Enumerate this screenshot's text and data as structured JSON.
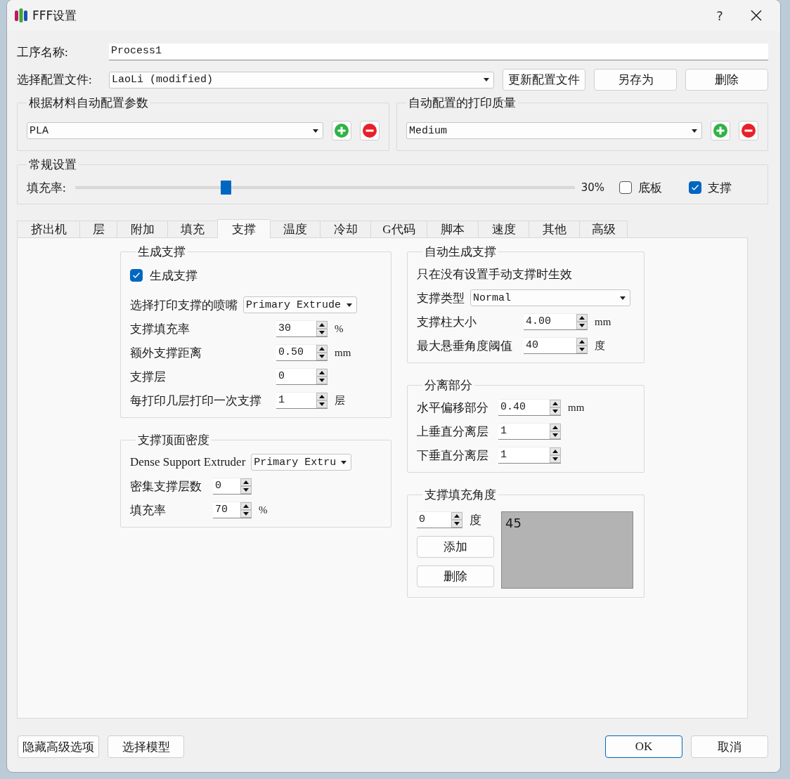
{
  "window": {
    "title": "FFF设置",
    "help": "?"
  },
  "process_name": {
    "label": "工序名称:",
    "value": "Process1"
  },
  "profile": {
    "label": "选择配置文件:",
    "value": "LaoLi (modified)",
    "buttons": [
      "更新配置文件",
      "另存为",
      "删除"
    ]
  },
  "auto_groups": [
    {
      "title": "根据材料自动配置参数",
      "value": "PLA"
    },
    {
      "title": "自动配置的打印质量",
      "value": "Medium"
    }
  ],
  "general": {
    "title": "常规设置",
    "infill_label": "填充率:",
    "infill": {
      "level": 0.3
    },
    "infill_reading": "30%",
    "checkboxes": [
      {
        "label": "底板",
        "checked": false
      },
      {
        "label": "支撑",
        "checked": true
      }
    ]
  },
  "tabs": [
    {
      "label": "挤出机",
      "selected": false
    },
    {
      "label": "层",
      "selected": false
    },
    {
      "label": "附加",
      "selected": false
    },
    {
      "label": "填充",
      "selected": false
    },
    {
      "label": "支撑",
      "selected": true
    },
    {
      "label": "温度",
      "selected": false
    },
    {
      "label": "冷却",
      "selected": false
    },
    {
      "label": "G代码",
      "selected": false
    },
    {
      "label": "脚本",
      "selected": false
    },
    {
      "label": "速度",
      "selected": false
    },
    {
      "label": "其他",
      "selected": false
    },
    {
      "label": "高级",
      "selected": false
    }
  ],
  "panel": {
    "columns": [
      [
        {
          "title": "生成支撑",
          "rows": [
            {
              "kind": "checkbox",
              "label": "生成支撑",
              "checked": true
            },
            {
              "kind": "combo",
              "label": "选择打印支撑的喷嘴",
              "value": "Primary Extrude"
            },
            {
              "kind": "spin",
              "label": "支撑填充率",
              "value": "30",
              "unit": "%"
            },
            {
              "kind": "spin",
              "label": "额外支撑距离",
              "value": "0.50",
              "unit": "mm"
            },
            {
              "kind": "spin",
              "label": "支撑层",
              "value": "0"
            },
            {
              "kind": "spin",
              "label": "每打印几层打印一次支撑",
              "value": "1",
              "unit": "层"
            }
          ]
        },
        {
          "title": "支撑顶面密度",
          "rows": [
            {
              "kind": "combo",
              "label": "Dense Support Extruder",
              "value": "Primary Extru"
            },
            {
              "kind": "spin",
              "label": "密集支撑层数",
              "value": "0"
            },
            {
              "kind": "spin",
              "label": "填充率",
              "value": "70",
              "unit": "%"
            }
          ]
        }
      ],
      [
        {
          "title": "自动生成支撑",
          "rows": [
            {
              "kind": "note",
              "label": "只在没有设置手动支撑时生效"
            },
            {
              "kind": "combo",
              "label": "支撑类型",
              "value": "Normal"
            },
            {
              "kind": "spin",
              "label": "支撑柱大小",
              "value": "4.00",
              "unit": "mm"
            },
            {
              "kind": "spin",
              "label": "最大悬垂角度阈值",
              "value": "40",
              "unit": "度"
            }
          ]
        },
        {
          "title": "分离部分",
          "rows": [
            {
              "kind": "spin",
              "label": "水平偏移部分",
              "value": "0.40",
              "unit": "mm"
            },
            {
              "kind": "spin",
              "label": "上垂直分离层",
              "value": "1"
            },
            {
              "kind": "spin",
              "label": "下垂直分离层",
              "value": "1"
            }
          ]
        },
        {
          "title": "支撑填充角度",
          "rows": [
            {
              "kind": "angle_editor",
              "value": "0",
              "unit": "度",
              "buttons": [
                "添加",
                "删除"
              ],
              "list_items": [
                "45"
              ]
            }
          ]
        }
      ]
    ]
  },
  "footer": {
    "left_buttons": [
      "隐藏高级选项",
      "选择模型"
    ],
    "right_buttons": [
      {
        "label": "OK",
        "default": true
      },
      {
        "label": "取消",
        "default": false
      }
    ]
  }
}
